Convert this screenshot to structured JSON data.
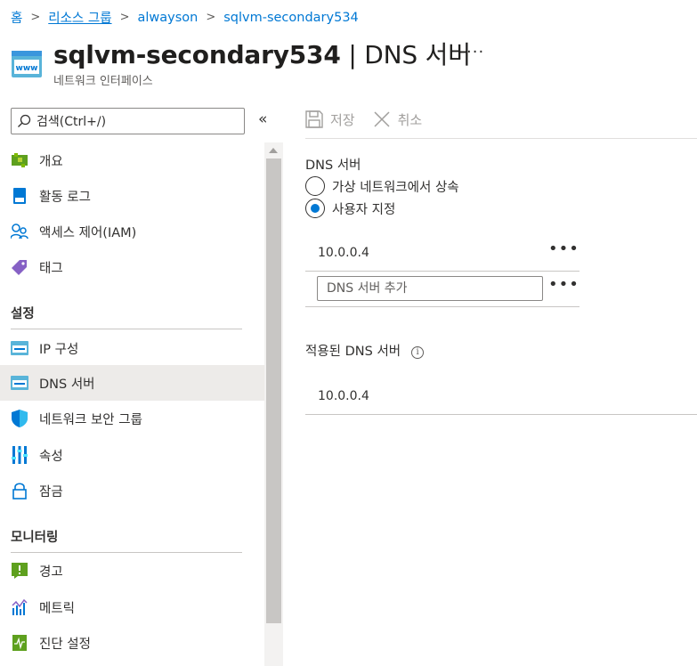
{
  "breadcrumb": {
    "items": [
      "홈",
      "리소스 그룹",
      "alwayson",
      "sqlvm-secondary534"
    ],
    "separator": ">"
  },
  "header": {
    "title_bold": "sqlvm-secondary534",
    "title_rest": " | DNS 서버",
    "more": "···",
    "subtitle": "네트워크 인터페이스"
  },
  "sidebar": {
    "search_placeholder": "검색(Ctrl+/)",
    "collapse": "«",
    "top_items": [
      {
        "label": "개요",
        "icon": "overview-icon"
      },
      {
        "label": "활동 로그",
        "icon": "activity-log-icon"
      },
      {
        "label": "액세스 제어(IAM)",
        "icon": "iam-icon"
      },
      {
        "label": "태그",
        "icon": "tag-icon"
      }
    ],
    "section_settings": "설정",
    "settings_items": [
      {
        "label": "IP 구성",
        "icon": "ip-config-icon"
      },
      {
        "label": "DNS 서버",
        "icon": "dns-server-icon",
        "active": true
      },
      {
        "label": "네트워크 보안 그룹",
        "icon": "shield-icon"
      },
      {
        "label": "속성",
        "icon": "properties-icon"
      },
      {
        "label": "잠금",
        "icon": "lock-icon"
      }
    ],
    "section_monitoring": "모니터링",
    "monitoring_items": [
      {
        "label": "경고",
        "icon": "alert-icon"
      },
      {
        "label": "메트릭",
        "icon": "metrics-icon"
      },
      {
        "label": "진단 설정",
        "icon": "diagnostic-icon"
      }
    ]
  },
  "toolbar": {
    "save_label": "저장",
    "discard_label": "취소"
  },
  "main": {
    "dns_servers_label": "DNS 서버",
    "radio_inherit": "가상 네트워크에서 상속",
    "radio_custom": "사용자 지정",
    "selected": "custom",
    "dns_entries": [
      "10.0.0.4"
    ],
    "add_placeholder": "DNS 서버 추가",
    "row_more": "•••",
    "applied_label": "적용된 DNS 서버",
    "info": "i",
    "applied_entries": [
      "10.0.0.4"
    ]
  },
  "colors": {
    "accent": "#0078d4",
    "active_bg": "#edebe9",
    "disabled_text": "#a19f9d"
  }
}
